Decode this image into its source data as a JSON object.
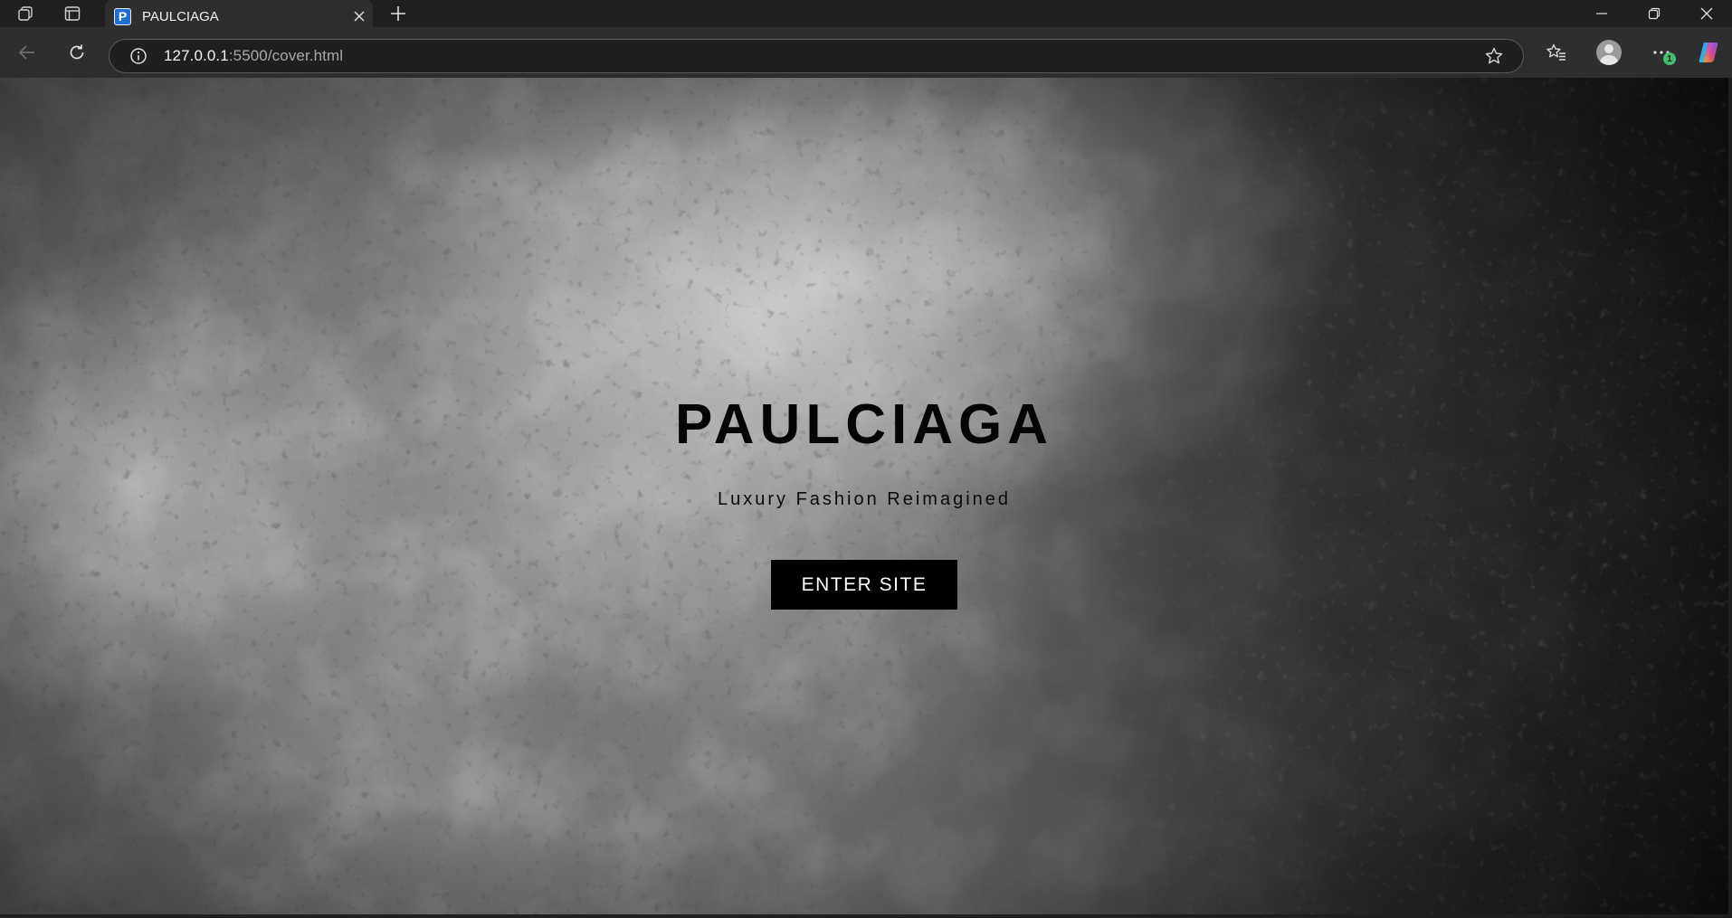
{
  "browser": {
    "tab": {
      "favicon_letter": "P",
      "title": "PAULCIAGA"
    },
    "address": {
      "host": "127.0.0.1",
      "rest": ":5500/cover.html"
    },
    "extensions_badge": "1",
    "icons": {
      "workspaces": "workspaces-icon",
      "tab_actions": "tab-actions-icon",
      "close_tab": "close-icon",
      "new_tab": "plus-icon",
      "minimize": "minimize-icon",
      "restore": "restore-icon",
      "close_window": "close-window-icon",
      "back": "back-arrow-icon",
      "refresh": "refresh-icon",
      "site_info": "info-icon",
      "favorite": "star-icon",
      "favorites": "favorites-list-icon",
      "profile": "avatar-icon",
      "more": "more-icon",
      "copilot": "copilot-icon"
    }
  },
  "page": {
    "title": "PAULCIAGA",
    "tagline": "Luxury Fashion Reimagined",
    "enter_button": "ENTER SITE"
  },
  "colors": {
    "title_text": "#050505",
    "button_bg": "#000000",
    "button_text": "#ffffff",
    "badge": "#3fbf6b",
    "favicon": "#1e6fd0"
  }
}
